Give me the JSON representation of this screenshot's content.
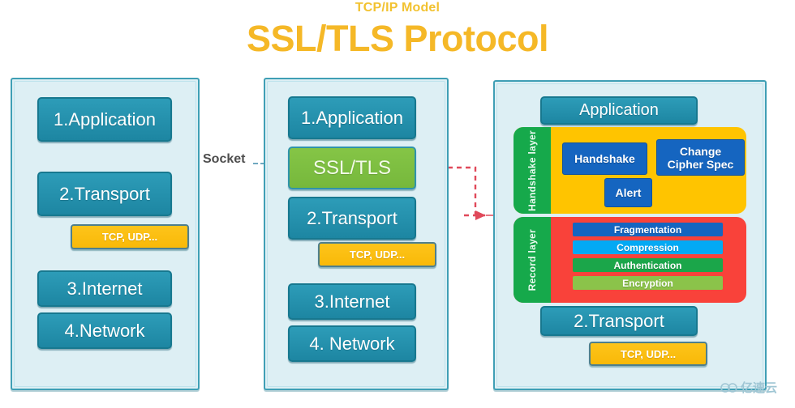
{
  "header": {
    "subtitle": "TCP/IP Model",
    "title": "SSL/TLS Protocol",
    "subtitle_color": "#f2c230",
    "title_color": "#f5b827"
  },
  "connectors": {
    "socket_label": "Socket",
    "socket_line_color": "#6fa8c0",
    "detail_arrow_color": "#e0495a",
    "bracket_color": "#d98d9e"
  },
  "columns": [
    {
      "name": "tcpip-stack",
      "boxes": [
        {
          "label": "1.Application",
          "style": "teal"
        },
        {
          "label": "2.Transport",
          "style": "teal"
        },
        {
          "label": "TCP, UDP...",
          "style": "orange"
        },
        {
          "label": "3.Internet",
          "style": "teal"
        },
        {
          "label": "4.Network",
          "style": "teal"
        }
      ]
    },
    {
      "name": "tcpip-stack-with-ssl",
      "boxes": [
        {
          "label": "1.Application",
          "style": "teal"
        },
        {
          "label": "SSL/TLS",
          "style": "green"
        },
        {
          "label": "2.Transport",
          "style": "teal"
        },
        {
          "label": "TCP, UDP...",
          "style": "orange"
        },
        {
          "label": "3.Internet",
          "style": "teal"
        },
        {
          "label": "4. Network",
          "style": "teal"
        }
      ]
    },
    {
      "name": "ssl-tls-detail",
      "application_label": "Application",
      "transport_label": "2.Transport",
      "tcp_udp_label": "TCP, UDP...",
      "handshake_layer": {
        "tab_label": "Handshake layer",
        "tab_color": "#16a94b",
        "body_color": "#ffc400",
        "items": [
          {
            "label": "Handshake",
            "color": "#1565c0"
          },
          {
            "label": "Change\nCipher Spec",
            "color": "#1565c0"
          },
          {
            "label": "Alert",
            "color": "#1565c0"
          }
        ]
      },
      "record_layer": {
        "tab_label": "Record layer",
        "tab_color": "#16a94b",
        "body_color": "#f9423a",
        "items": [
          {
            "label": "Fragmentation",
            "color": "#1565c0"
          },
          {
            "label": "Compression",
            "color": "#03a9f4"
          },
          {
            "label": "Authentication",
            "color": "#1ba64a"
          },
          {
            "label": "Encryption",
            "color": "#8bc34a"
          }
        ]
      }
    }
  ],
  "watermark": {
    "text": "亿速云",
    "icon": "cloud-icon",
    "color": "#9fc6d4"
  },
  "palette": {
    "panel_fill": "#ddeff4",
    "panel_border": "#3f9fb5",
    "teal_box": "#2196ad",
    "green_box": "#7ac143",
    "orange_box": "#fbbc05"
  }
}
